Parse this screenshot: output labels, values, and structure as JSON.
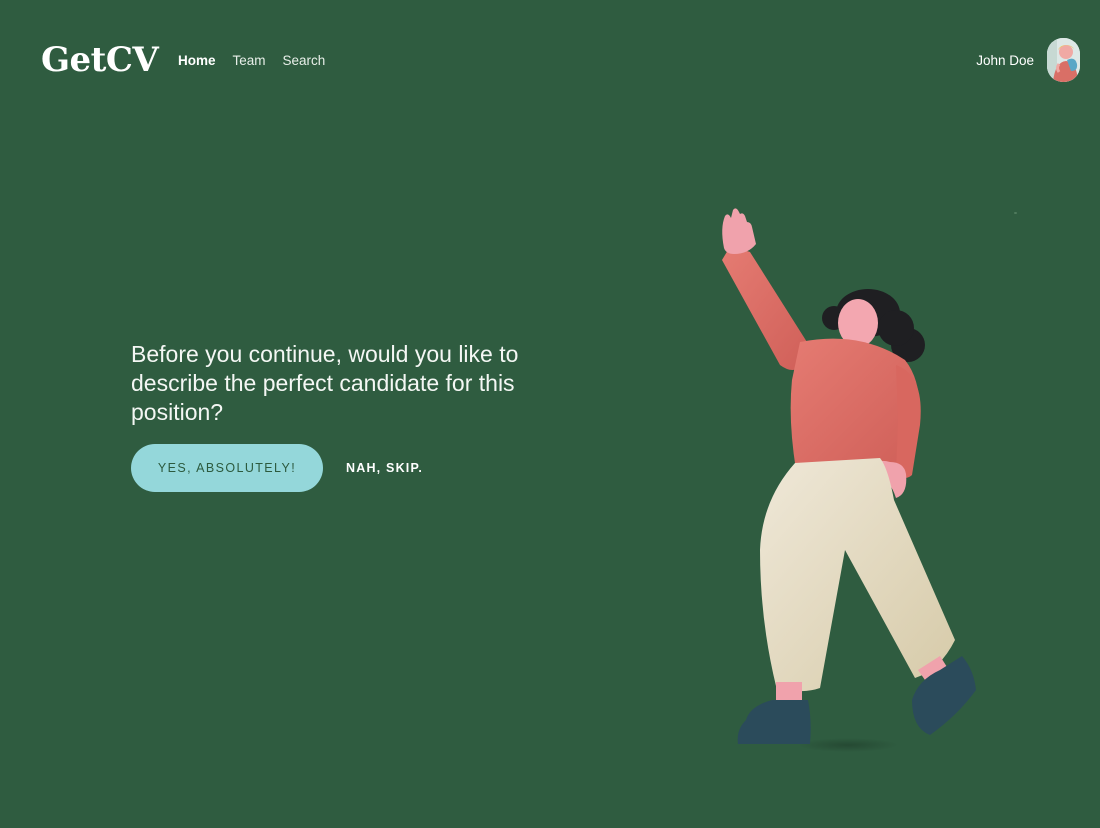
{
  "header": {
    "logo": "GetCV",
    "nav": [
      {
        "label": "Home",
        "active": true
      },
      {
        "label": "Team",
        "active": false
      },
      {
        "label": "Search",
        "active": false
      }
    ],
    "user_name": "John Doe"
  },
  "hero": {
    "question": "Before you continue, would you like to describe the perfect candidate for this position?",
    "primary_button": "YES, ABSOLUTELY!",
    "secondary_button": "NAH, SKIP."
  },
  "colors": {
    "background": "#2f5c40",
    "primary_button_bg": "#94d7da",
    "primary_button_text": "#2c5a3e",
    "shirt": "#e0756c",
    "pants": "#e4dcc6",
    "shoes": "#2b4b5b",
    "hair": "#1f1f22",
    "skin": "#f0a2ac"
  },
  "icons": {
    "avatar": "user-avatar-illustration",
    "illustration": "waving-woman-illustration"
  }
}
